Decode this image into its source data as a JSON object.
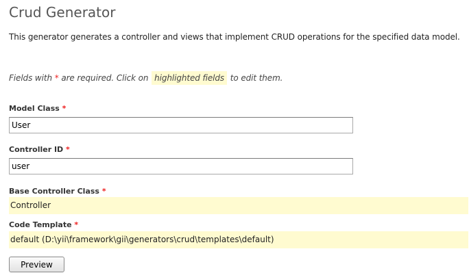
{
  "title": "Crud Generator",
  "description": "This generator generates a controller and views that implement CRUD operations for the specified data model.",
  "note": {
    "prefix": "Fields with ",
    "required_mark": "*",
    "middle": " are required. Click on ",
    "highlight": "highlighted fields",
    "suffix": " to edit them."
  },
  "form": {
    "model_class": {
      "label": "Model Class",
      "required_mark": "*",
      "value": "User"
    },
    "controller_id": {
      "label": "Controller ID",
      "required_mark": "*",
      "value": "user"
    },
    "base_controller_class": {
      "label": "Base Controller Class",
      "required_mark": "*",
      "value": "Controller"
    },
    "code_template": {
      "label": "Code Template",
      "required_mark": "*",
      "value": "default (D:\\yii\\framework\\gii\\generators\\crud\\templates\\default)"
    }
  },
  "preview_button": "Preview",
  "colors": {
    "highlight_bg": "#fffbd0",
    "required": "#ee2222",
    "heading": "#555555"
  }
}
